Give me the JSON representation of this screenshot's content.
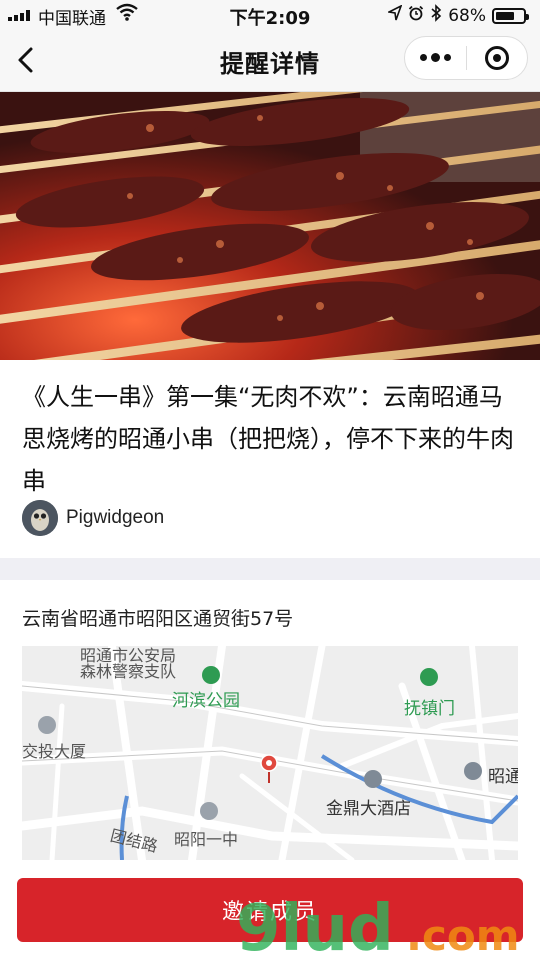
{
  "status_bar": {
    "carrier": "中国联通",
    "time": "下午2:09",
    "battery": "68%",
    "battery_level": 0.68
  },
  "nav": {
    "title": "提醒详情"
  },
  "article": {
    "headline": "《人生一串》第一集“无肉不欢”：云南昭通马思烧烤的昭通小串（把把烧），停不下来的牛肉串",
    "author": "Pigwidgeon"
  },
  "location": {
    "address": "云南省昭通市昭阳区通贸街57号",
    "map_labels": {
      "police": "昭通市公安局",
      "police2": "森林警察支队",
      "park": "河滨公园",
      "gate": "抚镇门",
      "building": "交投大厦",
      "hotel": "金鼎大酒店",
      "school": "昭阳一中",
      "road": "团结路",
      "zhaotong": "昭通",
      "edge": "昭通"
    }
  },
  "actions": {
    "invite": "邀请成员"
  },
  "watermark": {
    "text": "9lud.com"
  },
  "colors": {
    "accent": "#d7242a",
    "map_green": "#2e9b52",
    "river": "#5b8fd6"
  }
}
